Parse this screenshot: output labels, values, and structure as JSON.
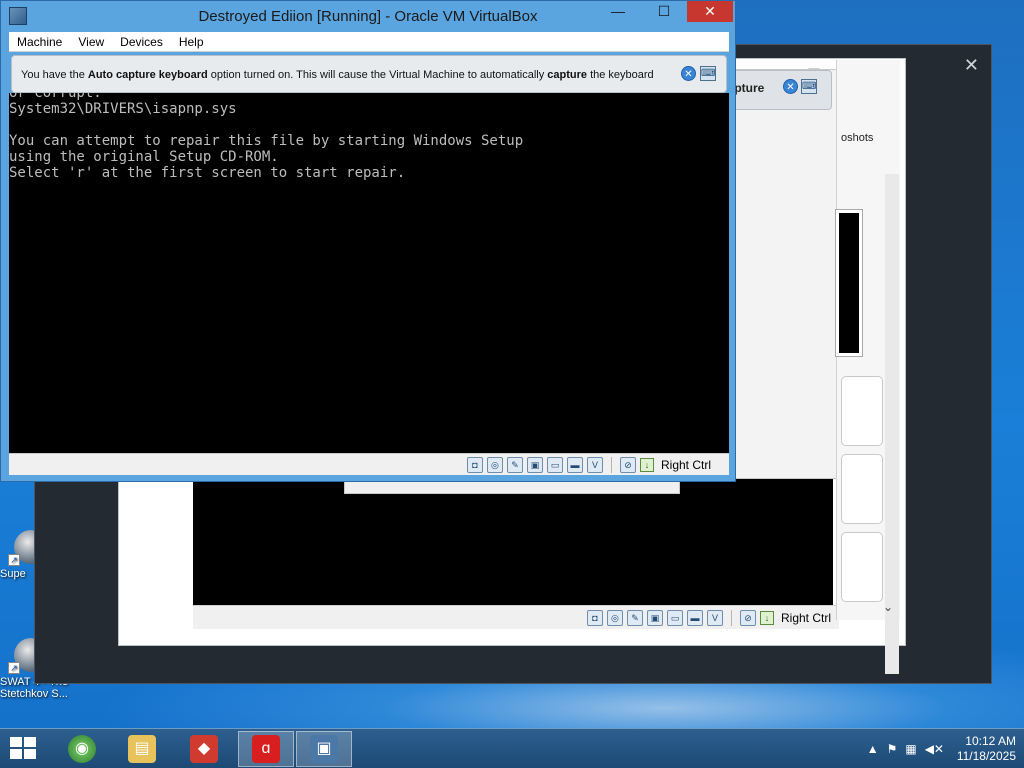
{
  "window": {
    "title": "Destroyed Ediion [Running] - Oracle VM VirtualBox",
    "min_glyph": "—",
    "max_glyph": "☐",
    "close_glyph": "✕"
  },
  "menu": [
    "Machine",
    "View",
    "Devices",
    "Help"
  ],
  "notice": {
    "part1": "You have the ",
    "bold1": "Auto capture keyboard",
    "part2": " option turned on. This will cause the Virtual Machine to automatically ",
    "bold2": "capture",
    "part3": " the keyboard"
  },
  "console": {
    "line0": "or corrupt:",
    "line1": "System32\\DRIVERS\\isapnp.sys",
    "line2": "",
    "line3": "You can attempt to repair this file by starting Windows Setup",
    "line4": "using the original Setup CD-ROM.",
    "line5": "Select 'r' at the first screen to start repair."
  },
  "statusbar": {
    "host_key": "Right Ctrl"
  },
  "background_window": {
    "host_key": "Right Ctrl",
    "snapshots_label": "oshots",
    "capture_label": "capture",
    "close_glyph": "✕"
  },
  "desktop": {
    "icon_super": "Supe",
    "icon_swat": "SWAT 4 - The Stetchkov S..."
  },
  "taskbar": {
    "time": "10:12 AM",
    "date": "11/18/2025"
  },
  "colors": {
    "accent": "#5aa5e0",
    "close_red": "#c7372f",
    "console_text": "#bdbdbd"
  }
}
